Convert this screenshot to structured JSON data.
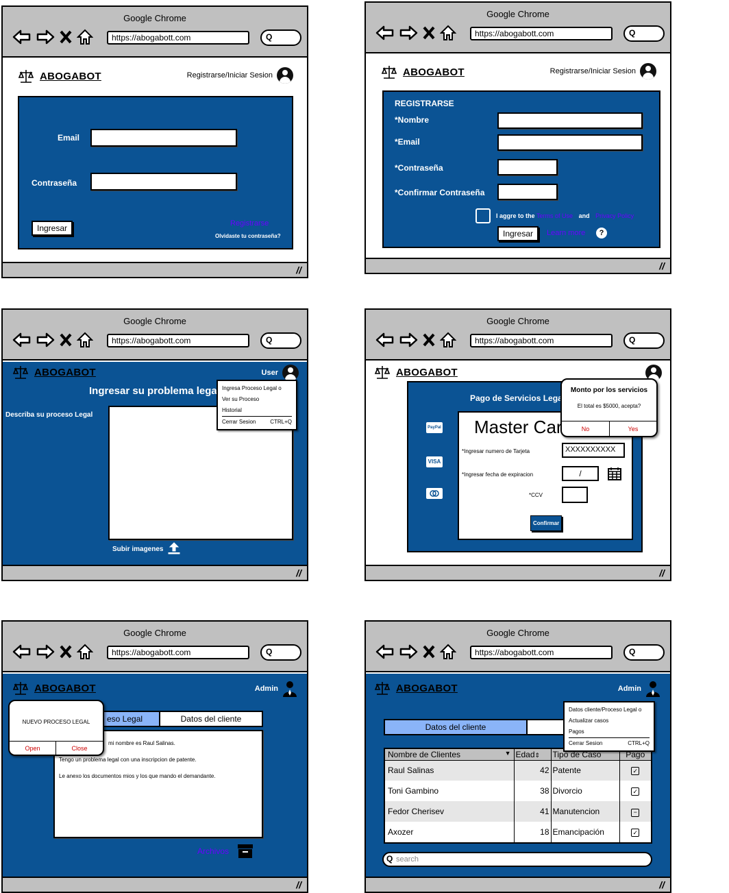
{
  "browser": {
    "title": "Google Chrome",
    "url": "https://abogabott.com",
    "search_glyph": "Q"
  },
  "brand": {
    "name": "ABOGABOT",
    "logo_icon": "scales-icon"
  },
  "colors": {
    "panel": "#0b5394",
    "chrome": "#c0c0c0",
    "link": "#6b00ff",
    "danger": "#cc0000"
  },
  "login": {
    "header_link": "Registrarse/Iniciar Sesion",
    "email_label": "Email",
    "password_label": "Contraseña",
    "submit": "Ingresar",
    "register_link": "Registrarse",
    "forgot": "Olvidaste tu contraseña?"
  },
  "register": {
    "header_link": "Registrarse/Iniciar Sesion",
    "title": "REGISTRARSE",
    "name_label": "*Nombre",
    "email_label": "*Email",
    "password_label": "*Contraseña",
    "confirm_label": "*Confirmar Contraseña",
    "agree": "I aggre to the",
    "terms": "Terms of Use",
    "and": "and",
    "privacy": "Privacy Policy",
    "submit": "Ingresar",
    "learn_more": "Learn more"
  },
  "problem": {
    "user_label": "User",
    "title": "Ingresar su problema legal",
    "describe": "Describa su proceso Legal",
    "upload": "Subir imagenes",
    "menu": [
      {
        "label": "Ingresa Proceso Legal o",
        "shortcut": ""
      },
      {
        "label": "Ver su Proceso",
        "shortcut": ""
      },
      {
        "label": "Historial",
        "shortcut": ""
      },
      {
        "label": "Cerrar Sesion",
        "shortcut": "CTRL+Q"
      }
    ]
  },
  "payment": {
    "title": "Pago de Servicios Legales",
    "card_brand": "Master Card",
    "card_number_label": "*Ingresar numero de Tarjeta",
    "card_number": "XXXXXXXXXX",
    "expiry_label": "*Ingresar fecha de expiracion",
    "expiry_value": "/",
    "ccv_label": "*CCV",
    "confirm": "Confirmar",
    "methods": [
      "PayPal",
      "VISA",
      "mastercard"
    ],
    "dialog": {
      "title": "Monto por los servicios",
      "message": "El total es $5000, acepta?",
      "no": "No",
      "yes": "Yes"
    }
  },
  "admin_process": {
    "admin_label": "Admin",
    "tabs": [
      "Proceso Legal",
      "Datos del cliente"
    ],
    "tab_visible_text": "eso Legal",
    "text_lines": [
      "mi nombre es Raul Salinas.",
      "Tengo un problema legal con una inscripcion de patente.",
      "Le anexo los documentos mios y los que mando el demandante."
    ],
    "files_link": "Archivos",
    "dialog": {
      "title": "NUEVO PROCESO LEGAL",
      "open": "Open",
      "close": "Close"
    }
  },
  "admin_clients": {
    "admin_label": "Admin",
    "tab": "Datos del cliente",
    "menu": [
      {
        "label": "Datos cliente/Proceso Legal o",
        "shortcut": ""
      },
      {
        "label": "Actualizar casos",
        "shortcut": ""
      },
      {
        "label": "Pagos",
        "shortcut": ""
      },
      {
        "label": "Cerrar Sesion",
        "shortcut": "CTRL+Q"
      }
    ],
    "columns": [
      "Nombre de Clientes",
      "Edad",
      "Tipo de Caso",
      "Pago"
    ],
    "rows": [
      {
        "name": "Raul Salinas",
        "age": "42",
        "case": "Patente",
        "paid": "checked"
      },
      {
        "name": "Toni Gambino",
        "age": "38",
        "case": "Divorcio",
        "paid": "checked"
      },
      {
        "name": "Fedor Cherisev",
        "age": "41",
        "case": "Manutencion",
        "paid": "partial"
      },
      {
        "name": "Axozer",
        "age": "18",
        "case": "Emancipación",
        "paid": "checked"
      }
    ],
    "search_placeholder": "search"
  }
}
